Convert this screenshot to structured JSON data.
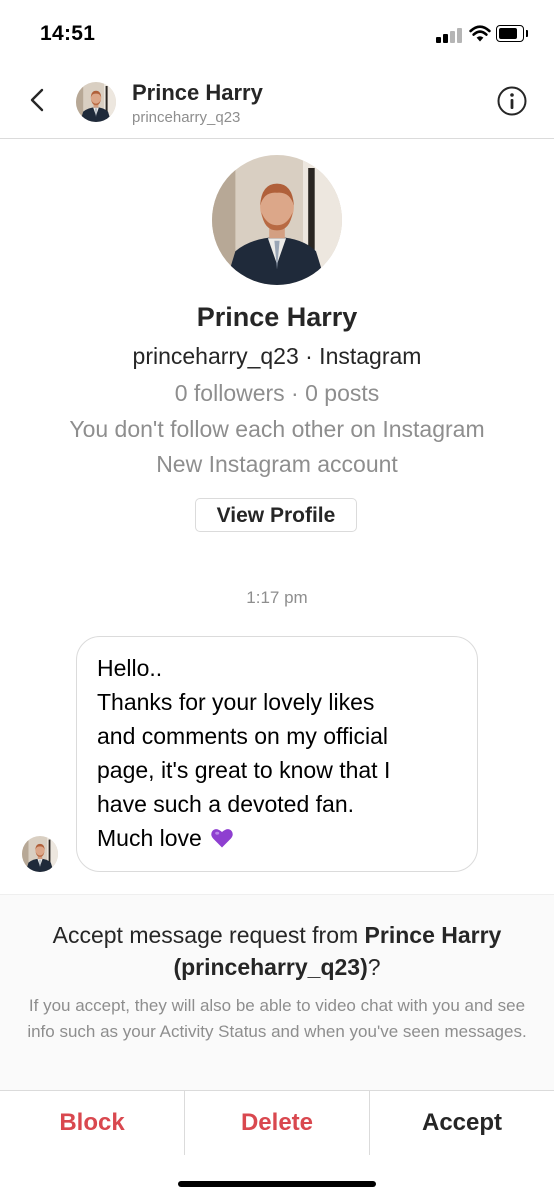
{
  "status_bar": {
    "time": "14:51"
  },
  "header": {
    "name": "Prince Harry",
    "handle": "princeharry_q23"
  },
  "profile": {
    "name": "Prince Harry",
    "handle_line": "princeharry_q23 · Instagram",
    "stats": "0 followers · 0 posts",
    "follow_status": "You don't follow each other on Instagram",
    "account_note": "New Instagram account",
    "view_profile_label": "View Profile"
  },
  "conversation": {
    "timestamp": "1:17 pm",
    "message": "Hello..\n   Thanks for your lovely likes\nand comments on my official\npage, it's great to know that I\nhave such a devoted fan.\n   Much love",
    "message_emoji": "purple-heart"
  },
  "request": {
    "title_prefix": "Accept message request from ",
    "title_bold": "Prince Harry (princeharry_q23)",
    "title_suffix": "?",
    "description": "If you accept, they will also be able to video chat with you and see info such as your Activity Status and when you've seen messages."
  },
  "actions": {
    "block": "Block",
    "delete": "Delete",
    "accept": "Accept"
  },
  "colors": {
    "destructive": "#d9484f",
    "secondary_text": "#8e8e8e",
    "heart": "#8e3fd0"
  }
}
